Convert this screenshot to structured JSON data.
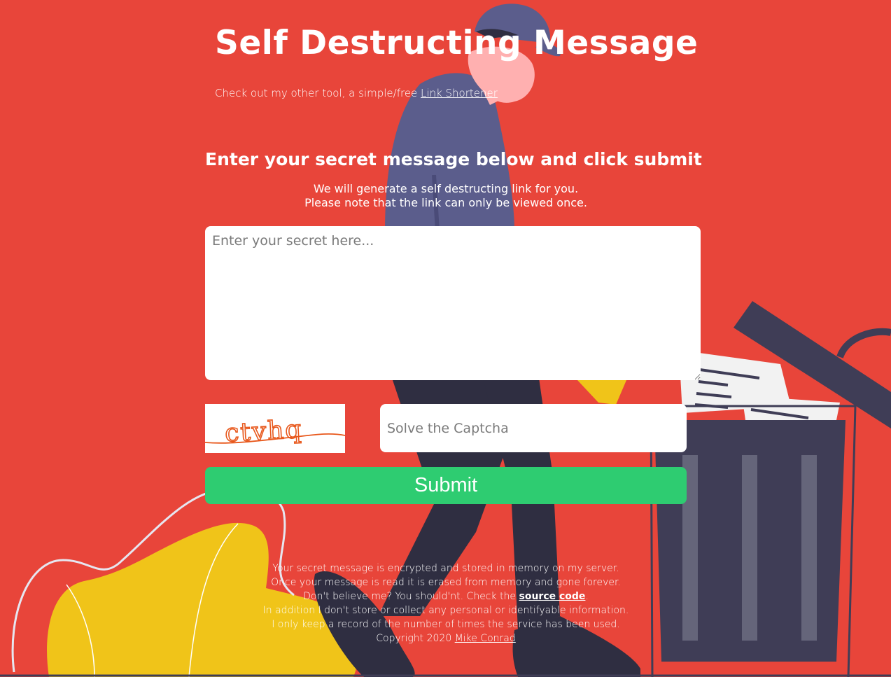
{
  "header": {
    "title": "Self Destructing Message",
    "promo_text": "Check out my other tool, a simple/free ",
    "promo_link": "Link Shortener"
  },
  "form": {
    "heading": "Enter your secret message below and click submit",
    "instruction_line1": "We will generate a self destructing link for you.",
    "instruction_line2": "Please note that the link can only be viewed once.",
    "secret_placeholder": "Enter your secret here...",
    "captcha_text": "ctvhq",
    "captcha_placeholder": "Solve the Captcha",
    "submit_label": "Submit"
  },
  "footer": {
    "line1": "Your secret message is encrypted and stored in memory on my server.",
    "line2": "Once your message is read it is erased from memory and gone forever.",
    "line3_prefix": "Don't believe me? You should'nt. Check the ",
    "source_link": "source code",
    "line3_suffix": ".",
    "line4": "In addition I don't store or collect any personal or identifyable information.",
    "line5": "I only keep a record of the number of times the service has been used.",
    "copyright_prefix": "Copyright 2020 ",
    "author_link": "Mike Conrad"
  },
  "colors": {
    "background": "#e8453a",
    "submit": "#2ecc71",
    "trash": "#3f3d56",
    "cap": "#5b5d8c",
    "blob": "#f0c419"
  },
  "illustration": {
    "icons": [
      "person-walking-illustration",
      "trash-can-illustration",
      "plant-blob-illustration"
    ]
  }
}
